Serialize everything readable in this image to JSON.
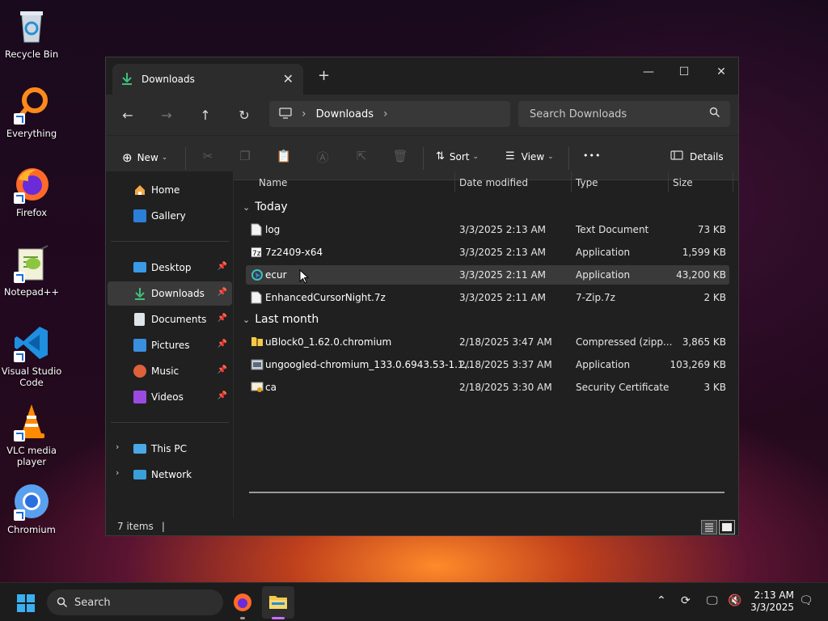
{
  "desktop": {
    "icons": [
      {
        "label": "Recycle Bin"
      },
      {
        "label": "Everything"
      },
      {
        "label": "Firefox"
      },
      {
        "label": "Notepad++"
      },
      {
        "label": "Visual Studio Code"
      },
      {
        "label": "VLC media player"
      },
      {
        "label": "Chromium"
      }
    ]
  },
  "window": {
    "tab_title": "Downloads",
    "new_tab_label": "+",
    "breadcrumb": "Downloads",
    "search_placeholder": "Search Downloads"
  },
  "toolbar": {
    "new_label": "New",
    "sort_label": "Sort",
    "view_label": "View",
    "more_label": "•••",
    "details_label": "Details"
  },
  "sidebar": {
    "items": [
      {
        "label": "Home"
      },
      {
        "label": "Gallery"
      },
      {
        "label": "Desktop"
      },
      {
        "label": "Downloads"
      },
      {
        "label": "Documents"
      },
      {
        "label": "Pictures"
      },
      {
        "label": "Music"
      },
      {
        "label": "Videos"
      },
      {
        "label": "This PC"
      },
      {
        "label": "Network"
      }
    ]
  },
  "columns": {
    "name": "Name",
    "date": "Date modified",
    "type": "Type",
    "size": "Size"
  },
  "groups": [
    {
      "label": "Today",
      "files": [
        {
          "name": "log",
          "date": "3/3/2025 2:13 AM",
          "type": "Text Document",
          "size": "73 KB"
        },
        {
          "name": "7z2409-x64",
          "date": "3/3/2025 2:13 AM",
          "type": "Application",
          "size": "1,599 KB"
        },
        {
          "name": "ecur",
          "date": "3/3/2025 2:11 AM",
          "type": "Application",
          "size": "43,200 KB"
        },
        {
          "name": "EnhancedCursorNight.7z",
          "date": "3/3/2025 2:11 AM",
          "type": "7-Zip.7z",
          "size": "2 KB"
        }
      ]
    },
    {
      "label": "Last month",
      "files": [
        {
          "name": "uBlock0_1.62.0.chromium",
          "date": "2/18/2025 3:47 AM",
          "type": "Compressed (zipp...",
          "size": "3,865 KB"
        },
        {
          "name": "ungoogled-chromium_133.0.6943.53-1.1...",
          "date": "2/18/2025 3:37 AM",
          "type": "Application",
          "size": "103,269 KB"
        },
        {
          "name": "ca",
          "date": "2/18/2025 3:30 AM",
          "type": "Security Certificate",
          "size": "3 KB"
        }
      ]
    }
  ],
  "status": {
    "item_count": "7 items",
    "cursor": "|"
  },
  "taskbar": {
    "search_label": "Search",
    "time": "2:13 AM",
    "date": "3/3/2025"
  }
}
